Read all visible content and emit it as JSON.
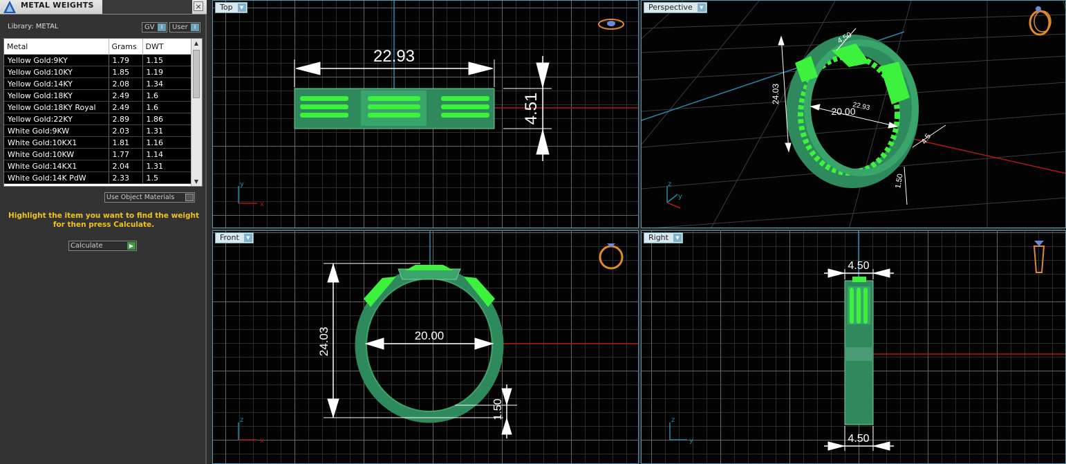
{
  "panel": {
    "title": "METAL WEIGHTS",
    "close_glyph": "×",
    "library_label": "Library: METAL",
    "toggle_gv": "GV",
    "toggle_user": "User",
    "table": {
      "headers": [
        "Metal",
        "Grams",
        "DWT"
      ],
      "rows": [
        [
          "Yellow Gold:9KY",
          "1.79",
          "1.15"
        ],
        [
          "Yellow Gold:10KY",
          "1.85",
          "1.19"
        ],
        [
          "Yellow Gold:14KY",
          "2.08",
          "1.34"
        ],
        [
          "Yellow Gold:18KY",
          "2.49",
          "1.6"
        ],
        [
          "Yellow Gold:18KY Royal",
          "2.49",
          "1.6"
        ],
        [
          "Yellow Gold:22KY",
          "2.89",
          "1.86"
        ],
        [
          "White Gold:9KW",
          "2.03",
          "1.31"
        ],
        [
          "White Gold:10KX1",
          "1.81",
          "1.16"
        ],
        [
          "White Gold:10KW",
          "1.77",
          "1.14"
        ],
        [
          "White Gold:14KX1",
          "2.04",
          "1.31"
        ],
        [
          "White Gold:14K PdW",
          "2.33",
          "1.5"
        ]
      ]
    },
    "use_object_materials": "Use Object Materials",
    "hint_line1": "Highlight the item you want to find the weight",
    "hint_line2": "for then press Calculate.",
    "calculate": "Calculate"
  },
  "viewports": {
    "top": {
      "label": "Top",
      "dim_width": "22.93",
      "dim_height": "4.51",
      "axis_y": "y",
      "axis_x": "x"
    },
    "perspective": {
      "label": "Perspective",
      "dim_top": "4.50",
      "dim_height": "24.03",
      "dim_inner": "20.00",
      "dim_outer": "22.93",
      "dim_side": "4.5",
      "dim_band": "1.50",
      "axis_z": "z",
      "axis_y": "y"
    },
    "front": {
      "label": "Front",
      "dim_height": "24.03",
      "dim_inner": "20.00",
      "dim_band": "1.50",
      "axis_z": "z",
      "axis_x": "x"
    },
    "right": {
      "label": "Right",
      "dim_top": "4.50",
      "dim_bottom": "4.50",
      "axis_z": "z",
      "axis_y": "y"
    }
  },
  "colors": {
    "accent": "#5a9ab5",
    "metal_green": "#2e8a5c",
    "bright_green": "#3df23d",
    "hint_yellow": "#f2c21a",
    "axis_red": "#b01818",
    "axis_cyan": "#2a8aa8"
  }
}
